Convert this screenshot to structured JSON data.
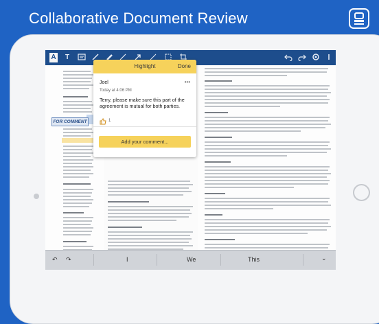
{
  "banner": {
    "title": "Collaborative Document Review"
  },
  "toolbar": {
    "tools": [
      "A",
      "T",
      "note-icon",
      "pen-icon",
      "marker-icon",
      "shape-icon",
      "line-icon",
      "stamp-icon",
      "crop-icon"
    ],
    "right": [
      "undo-icon",
      "redo-icon",
      "settings-icon",
      "share-icon"
    ]
  },
  "comment_panel": {
    "title": "Highlight",
    "done": "Done",
    "author": "Joel",
    "time": "Today at 4:06 PM",
    "text": "Terry, please make sure this part of the agreement is mutual for both parties.",
    "like_count": "1",
    "add_label": "Add your comment..."
  },
  "doc": {
    "for_comment_label": "FOR COMMENT"
  },
  "keyboard": {
    "undo": "↶",
    "redo": "↷",
    "suggestions": [
      "I",
      "We",
      "This"
    ],
    "dismiss": "⌄"
  }
}
